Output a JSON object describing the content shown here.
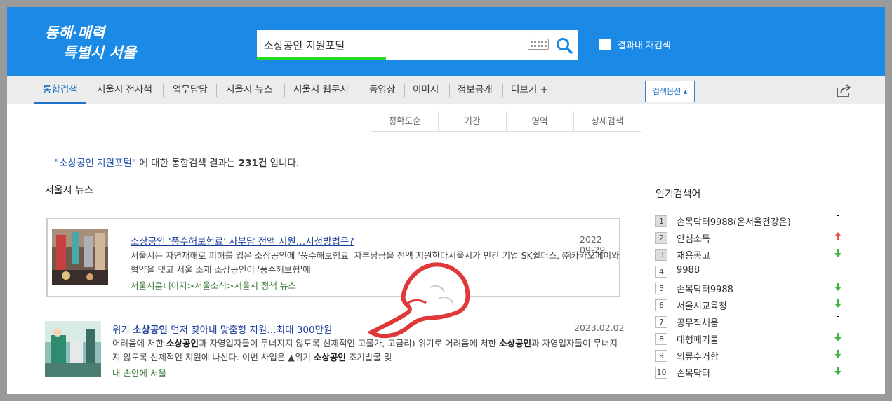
{
  "header": {
    "logo_text": "동해·매력 특별시 서울",
    "search_value": "소상공인 지원포털",
    "recheck_label": "결과내 재검색"
  },
  "nav": {
    "items": [
      "통합검색",
      "서울시 전자책",
      "업무담당",
      "서울시 뉴스",
      "서울시 웹문서",
      "동영상",
      "이미지",
      "정보공개",
      "더보기 +"
    ],
    "options_label": "검색옵션 ▴"
  },
  "subfilter": [
    "정확도순",
    "기간",
    "영역",
    "상세검색"
  ],
  "summary": {
    "query": "\"소상공인 지원포털\"",
    "middle": " 에 대한 통합검색 결과는 ",
    "count": "231건",
    "end": " 입니다."
  },
  "section_title": "서울시 뉴스",
  "results": [
    {
      "title": "소상공인 '풍수해보험료' 자부담 전액 지원…시청방법은?",
      "date": "2022-09-29",
      "body": "서울시는 자연재해로 피해를 입은 소상공인에 '풍수해보험료' 자부담금을 전액 지원한다서울시가 민간 기업 SK쉴더스, ㈜카카오페이와 협약을 맺고 서울 소재 소상공인이 '풍수해보험'에",
      "path": "서울시홈페이지>서울소식>서울시 정책 뉴스"
    },
    {
      "title_prefix": "위기 ",
      "title_bold": "소상공인",
      "title_suffix": " 먼저 찾아내 맞춤형 지원…최대 300만원",
      "date": "2023.02.02",
      "body_parts": [
        "어려움에 처한 ",
        "소상공인",
        "과 자영업자들이 무너지지 않도록 선제적인 고물가, 고금리) 위기로 어려움에 처한 ",
        "소상공인",
        "과 자영업자들이 무너지지 않도록 선제적인 지원에 나선다. 이번 사업은 ▲위기 ",
        "소상공인",
        " 조기발굴 및"
      ],
      "path": "내 손안에 서울"
    }
  ],
  "popular": {
    "title": "인기검색어",
    "items": [
      {
        "rank": "1",
        "label": "손목닥터9988(온서울건강온)",
        "trend": "-"
      },
      {
        "rank": "2",
        "label": "안심소득",
        "trend": "up"
      },
      {
        "rank": "3",
        "label": "채용공고",
        "trend": "down"
      },
      {
        "rank": "4",
        "label": "9988",
        "trend": "-"
      },
      {
        "rank": "5",
        "label": "손목닥터9988",
        "trend": "down"
      },
      {
        "rank": "6",
        "label": "서울시교육청",
        "trend": "down"
      },
      {
        "rank": "7",
        "label": "공무직채용",
        "trend": "-"
      },
      {
        "rank": "8",
        "label": "대형폐기물",
        "trend": "down"
      },
      {
        "rank": "9",
        "label": "의류수거함",
        "trend": "down"
      },
      {
        "rank": "10",
        "label": "손목닥터",
        "trend": "down"
      }
    ]
  },
  "colors": {
    "header_bg": "#1a8ae6",
    "accent": "#1a73c7",
    "trend_up": "#e8504a",
    "trend_down": "#3fb53f"
  }
}
